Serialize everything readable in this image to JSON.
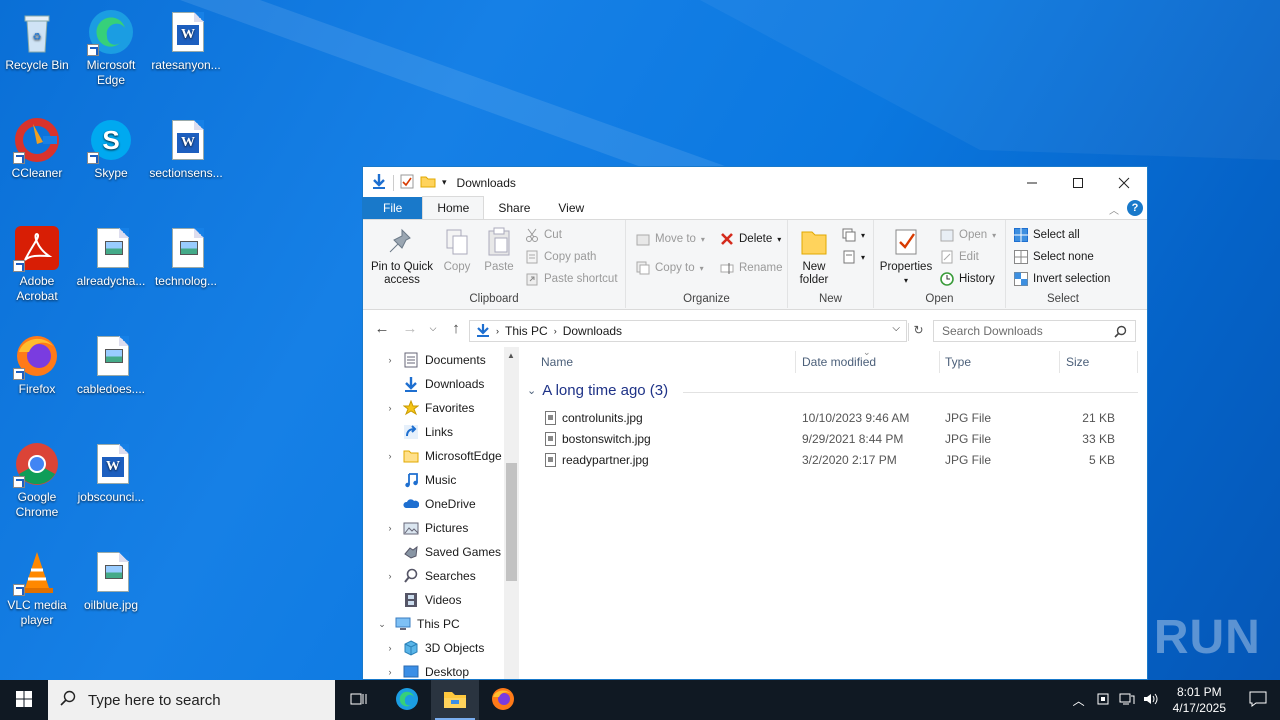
{
  "desktop": {
    "icons": [
      {
        "label": "Recycle Bin"
      },
      {
        "label": "Microsoft Edge"
      },
      {
        "label": "ratesanyon..."
      },
      {
        "label": "CCleaner"
      },
      {
        "label": "Skype"
      },
      {
        "label": "sectionsens..."
      },
      {
        "label": "Adobe Acrobat"
      },
      {
        "label": "alreadycha..."
      },
      {
        "label": "technolog..."
      },
      {
        "label": "Firefox"
      },
      {
        "label": "cabledoes...."
      },
      {
        "label": "Google Chrome"
      },
      {
        "label": "jobscounci..."
      },
      {
        "label": "VLC media player"
      },
      {
        "label": "oilblue.jpg"
      }
    ]
  },
  "window": {
    "title": "Downloads",
    "tabs": {
      "file": "File",
      "home": "Home",
      "share": "Share",
      "view": "View"
    },
    "help": "?"
  },
  "ribbon": {
    "clipboard": {
      "name": "Clipboard",
      "pin": "Pin to Quick access",
      "copy": "Copy",
      "paste": "Paste",
      "cut": "Cut",
      "copy_path": "Copy path",
      "paste_shortcut": "Paste shortcut"
    },
    "organize": {
      "name": "Organize",
      "move_to": "Move to",
      "copy_to": "Copy to",
      "delete": "Delete",
      "rename": "Rename"
    },
    "new": {
      "name": "New",
      "new_folder": "New folder"
    },
    "open": {
      "name": "Open",
      "properties": "Properties",
      "open": "Open",
      "edit": "Edit",
      "history": "History"
    },
    "select": {
      "name": "Select",
      "select_all": "Select all",
      "select_none": "Select none",
      "invert": "Invert selection"
    }
  },
  "address": {
    "segments": [
      "This PC",
      "Downloads"
    ],
    "search_placeholder": "Search Downloads"
  },
  "nav": {
    "items": [
      {
        "label": "Documents"
      },
      {
        "label": "Downloads"
      },
      {
        "label": "Favorites"
      },
      {
        "label": "Links"
      },
      {
        "label": "MicrosoftEdge"
      },
      {
        "label": "Music"
      },
      {
        "label": "OneDrive"
      },
      {
        "label": "Pictures"
      },
      {
        "label": "Saved Games"
      },
      {
        "label": "Searches"
      },
      {
        "label": "Videos"
      },
      {
        "label": "This PC"
      },
      {
        "label": "3D Objects"
      },
      {
        "label": "Desktop"
      }
    ]
  },
  "files": {
    "columns": {
      "name": "Name",
      "date": "Date modified",
      "type": "Type",
      "size": "Size"
    },
    "group_label": "A long time ago (3)",
    "rows": [
      {
        "name": "controlunits.jpg",
        "date": "10/10/2023 9:46 AM",
        "type": "JPG File",
        "size": "21 KB"
      },
      {
        "name": "bostonswitch.jpg",
        "date": "9/29/2021 8:44 PM",
        "type": "JPG File",
        "size": "33 KB"
      },
      {
        "name": "readypartner.jpg",
        "date": "3/2/2020 2:17 PM",
        "type": "JPG File",
        "size": "5 KB"
      }
    ]
  },
  "taskbar": {
    "search_placeholder": "Type here to search",
    "time": "8:01 PM",
    "date": "4/17/2025"
  },
  "watermark": "ANY RUN"
}
